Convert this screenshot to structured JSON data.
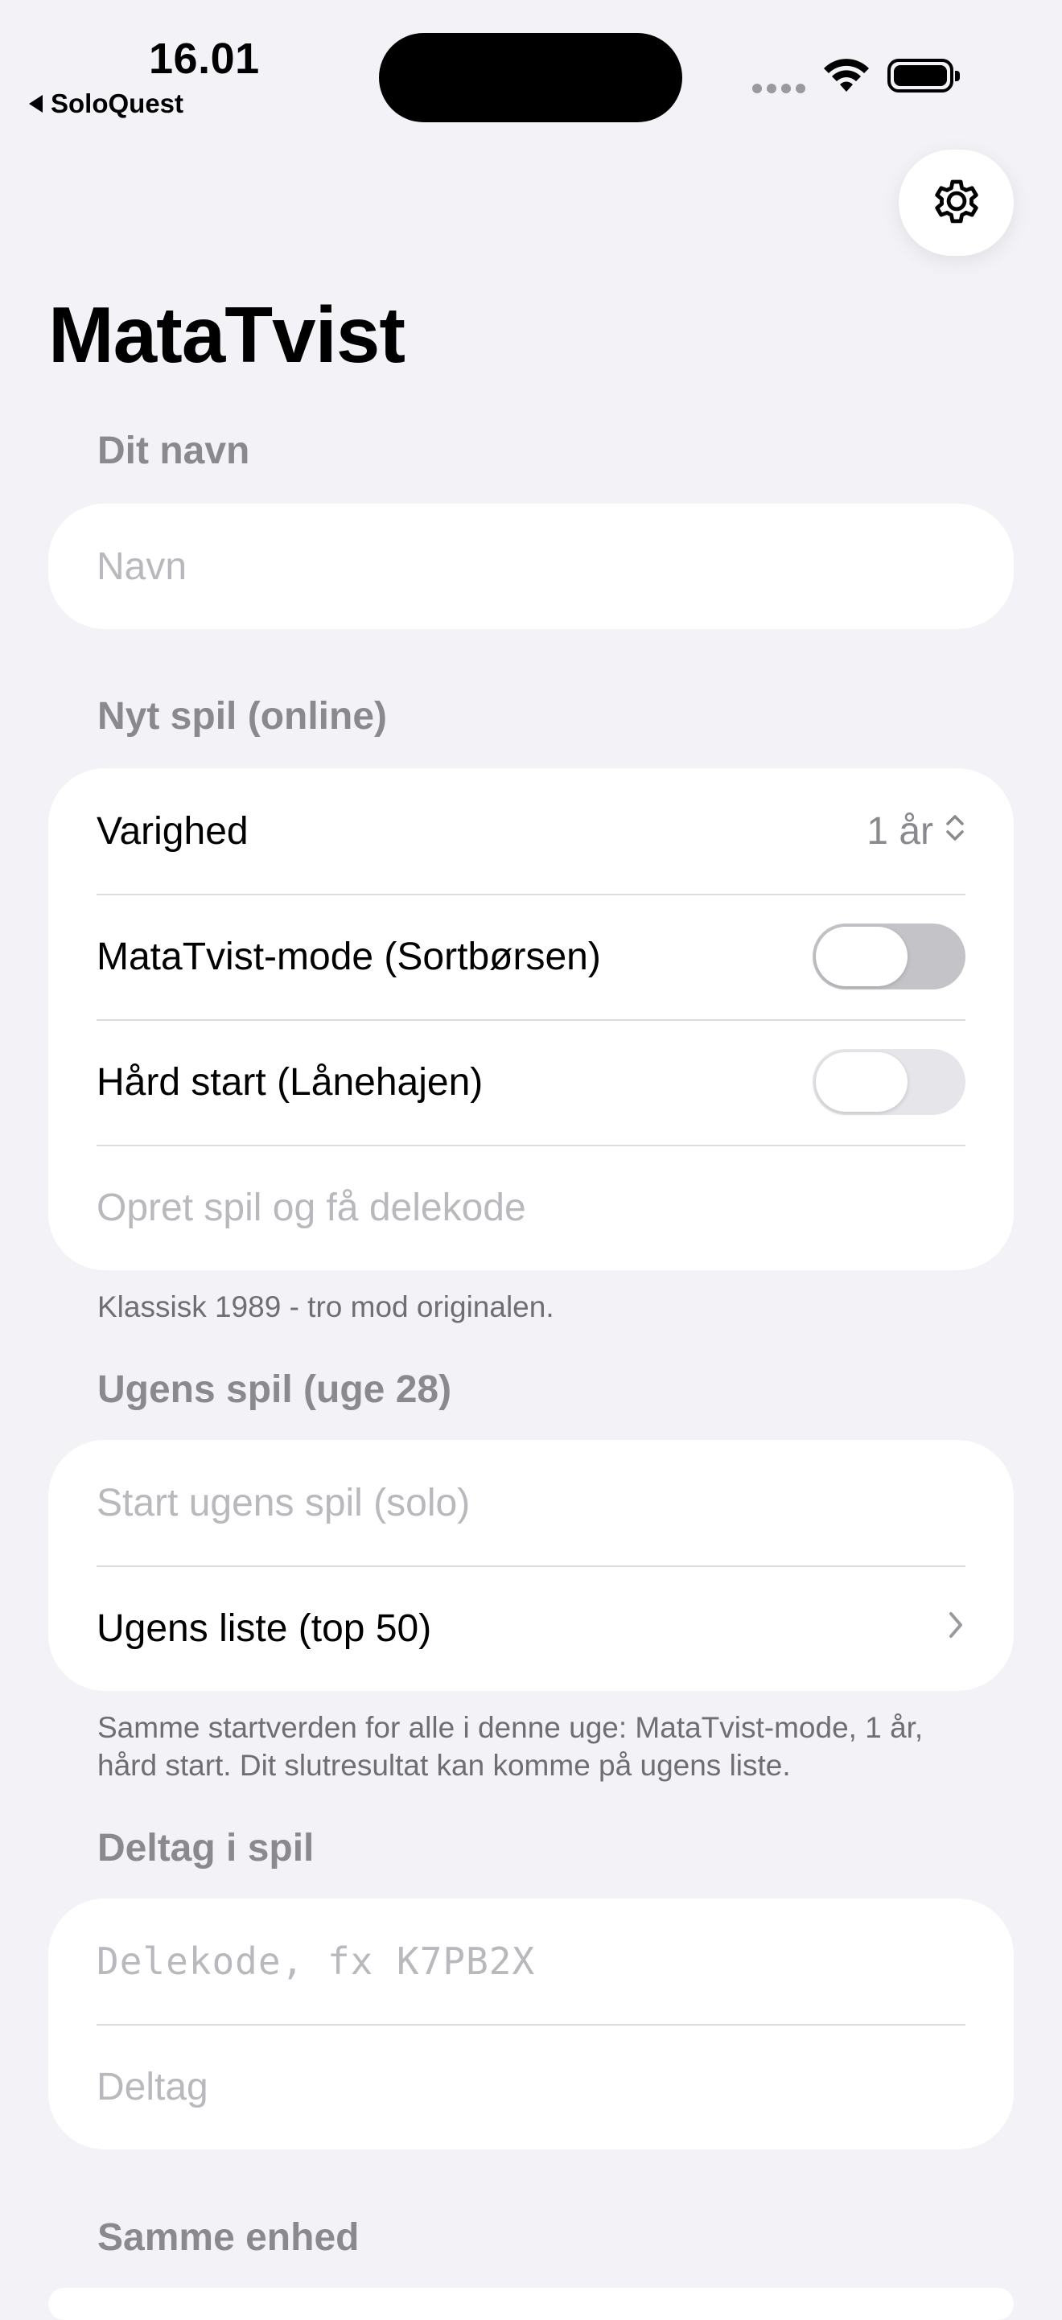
{
  "status_bar": {
    "time": "16.01",
    "back_app": "SoloQuest"
  },
  "page": {
    "title": "MataTvist"
  },
  "name_section": {
    "label": "Dit navn",
    "placeholder": "Navn"
  },
  "new_game": {
    "label": "Nyt spil (online)",
    "duration_label": "Varighed",
    "duration_value": "1 år",
    "mode_label": "MataTvist-mode (Sortbørsen)",
    "mode_on": false,
    "hard_start_label": "Hård start (Lånehajen)",
    "hard_start_on": false,
    "create_label": "Opret spil og få delekode",
    "footnote": "Klassisk 1989 - tro mod originalen."
  },
  "weekly": {
    "label": "Ugens spil (uge 28)",
    "start_label": "Start ugens spil (solo)",
    "list_label": "Ugens liste (top 50)",
    "footnote": "Samme startverden for alle i denne uge: MataTvist-mode, 1 år, hård start. Dit slutresultat kan komme på ugens liste."
  },
  "join": {
    "label": "Deltag i spil",
    "code_placeholder": "Delekode, fx K7PB2X",
    "join_label": "Deltag"
  },
  "same_device": {
    "label": "Samme enhed"
  },
  "icons": {
    "settings": "gear-icon",
    "stepper": "chevron-up-down-icon",
    "list_chevron": "chevron-right-icon",
    "back": "back-triangle-icon"
  }
}
